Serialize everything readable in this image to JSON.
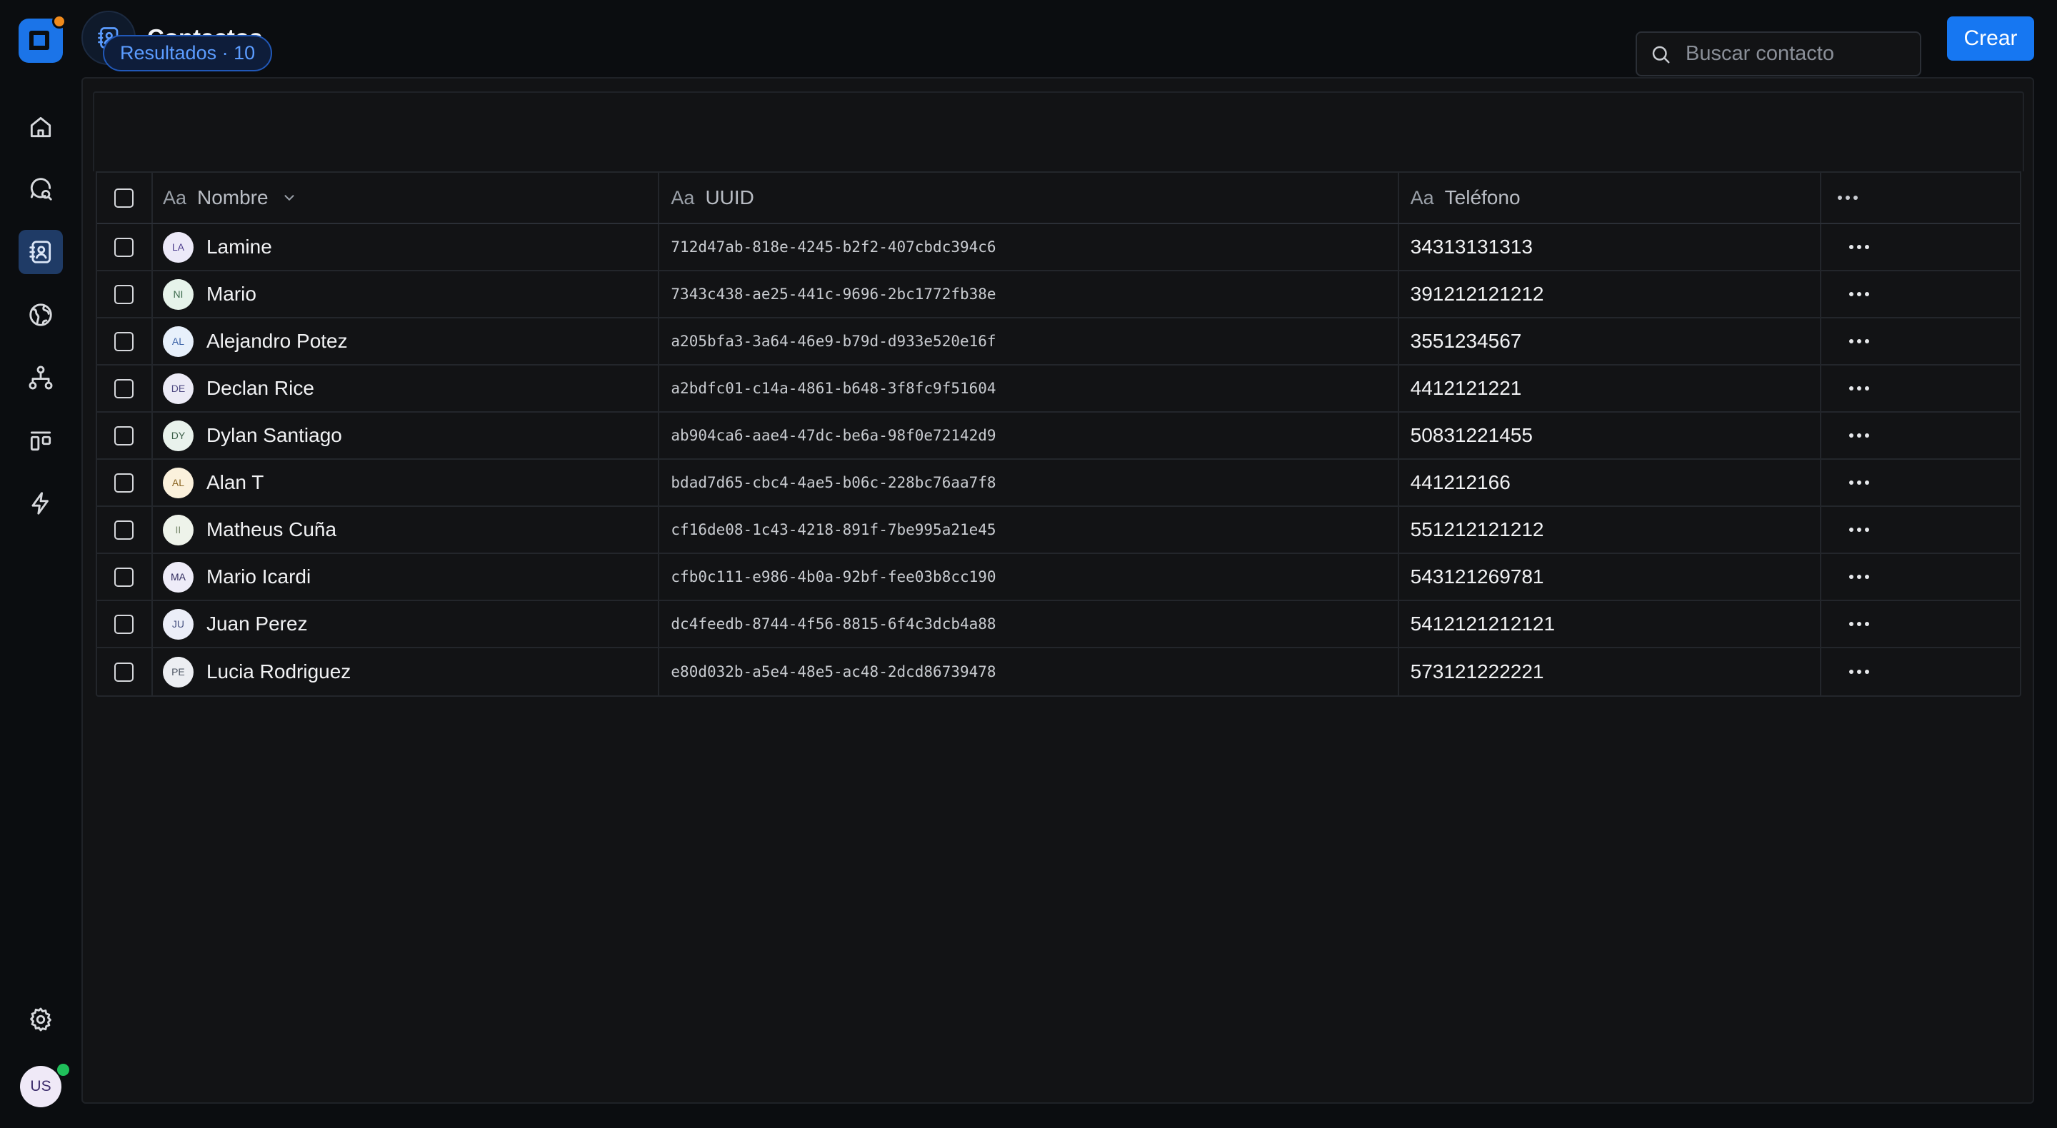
{
  "header": {
    "title": "Contactos",
    "create_label": "Crear"
  },
  "sidebar": {
    "items": [
      {
        "icon": "home-icon"
      },
      {
        "icon": "chat-search-icon"
      },
      {
        "icon": "contacts-icon",
        "active": true
      },
      {
        "icon": "globe-icon"
      },
      {
        "icon": "org-chart-icon"
      },
      {
        "icon": "board-icon"
      },
      {
        "icon": "lightning-icon"
      }
    ],
    "settings_icon": "gear-icon",
    "user_initials": "US"
  },
  "toolbar": {
    "results_label": "Resultados · 10",
    "search_placeholder": "Buscar contacto"
  },
  "table": {
    "columns": [
      {
        "type_label": "Aa",
        "label": "Nombre",
        "sortable": true
      },
      {
        "type_label": "Aa",
        "label": "UUID"
      },
      {
        "type_label": "Aa",
        "label": "Teléfono"
      }
    ],
    "rows": [
      {
        "initials": "LA",
        "name": "Lamine",
        "uuid": "712d47ab-818e-4245-b2f2-407cbdc394c6",
        "phone": "34313131313",
        "avatar_bg": "#ece9f8",
        "avatar_fg": "#4b3a8c"
      },
      {
        "initials": "NI",
        "name": "Mario",
        "uuid": "7343c438-ae25-441c-9696-2bc1772fb38e",
        "phone": "391212121212",
        "avatar_bg": "#e6f3ea",
        "avatar_fg": "#3d6b4d"
      },
      {
        "initials": "AL",
        "name": "Alejandro Potez",
        "uuid": "a205bfa3-3a64-46e9-b79d-d933e520e16f",
        "phone": "3551234567",
        "avatar_bg": "#e7f0fb",
        "avatar_fg": "#3d64a8"
      },
      {
        "initials": "DE",
        "name": "Declan Rice",
        "uuid": "a2bdfc01-c14a-4861-b648-3f8fc9f51604",
        "phone": "4412121221",
        "avatar_bg": "#ecebf6",
        "avatar_fg": "#514c84"
      },
      {
        "initials": "DY",
        "name": "Dylan Santiago",
        "uuid": "ab904ca6-aae4-47dc-be6a-98f0e72142d9",
        "phone": "50831221455",
        "avatar_bg": "#e9f2ec",
        "avatar_fg": "#3c5f48"
      },
      {
        "initials": "AL",
        "name": "Alan T",
        "uuid": "bdad7d65-cbc4-4ae5-b06c-228bc76aa7f8",
        "phone": "441212166",
        "avatar_bg": "#fbf1dc",
        "avatar_fg": "#8a6420"
      },
      {
        "initials": "II",
        "name": "Matheus Cuña",
        "uuid": "cf16de08-1c43-4218-891f-7be995a21e45",
        "phone": "551212121212",
        "avatar_bg": "#eef3ea",
        "avatar_fg": "#7a8a6e"
      },
      {
        "initials": "MA",
        "name": "Mario Icardi",
        "uuid": "cfb0c111-e986-4b0a-92bf-fee03b8cc190",
        "phone": "543121269781",
        "avatar_bg": "#eeecf8",
        "avatar_fg": "#2f2a5e"
      },
      {
        "initials": "JU",
        "name": "Juan Perez",
        "uuid": "dc4feedb-8744-4f56-8815-6f4c3dcb4a88",
        "phone": "5412121212121",
        "avatar_bg": "#ebeef8",
        "avatar_fg": "#45507f"
      },
      {
        "initials": "PE",
        "name": "Lucia Rodriguez",
        "uuid": "e80d032b-a5e4-48e5-ac48-2dcd86739478",
        "phone": "573121222221",
        "avatar_bg": "#eceef2",
        "avatar_fg": "#4d5563"
      }
    ]
  },
  "colors": {
    "accent": "#1677f2",
    "background": "#0b0d10",
    "panel": "#121315",
    "online": "#1fbf5a"
  }
}
